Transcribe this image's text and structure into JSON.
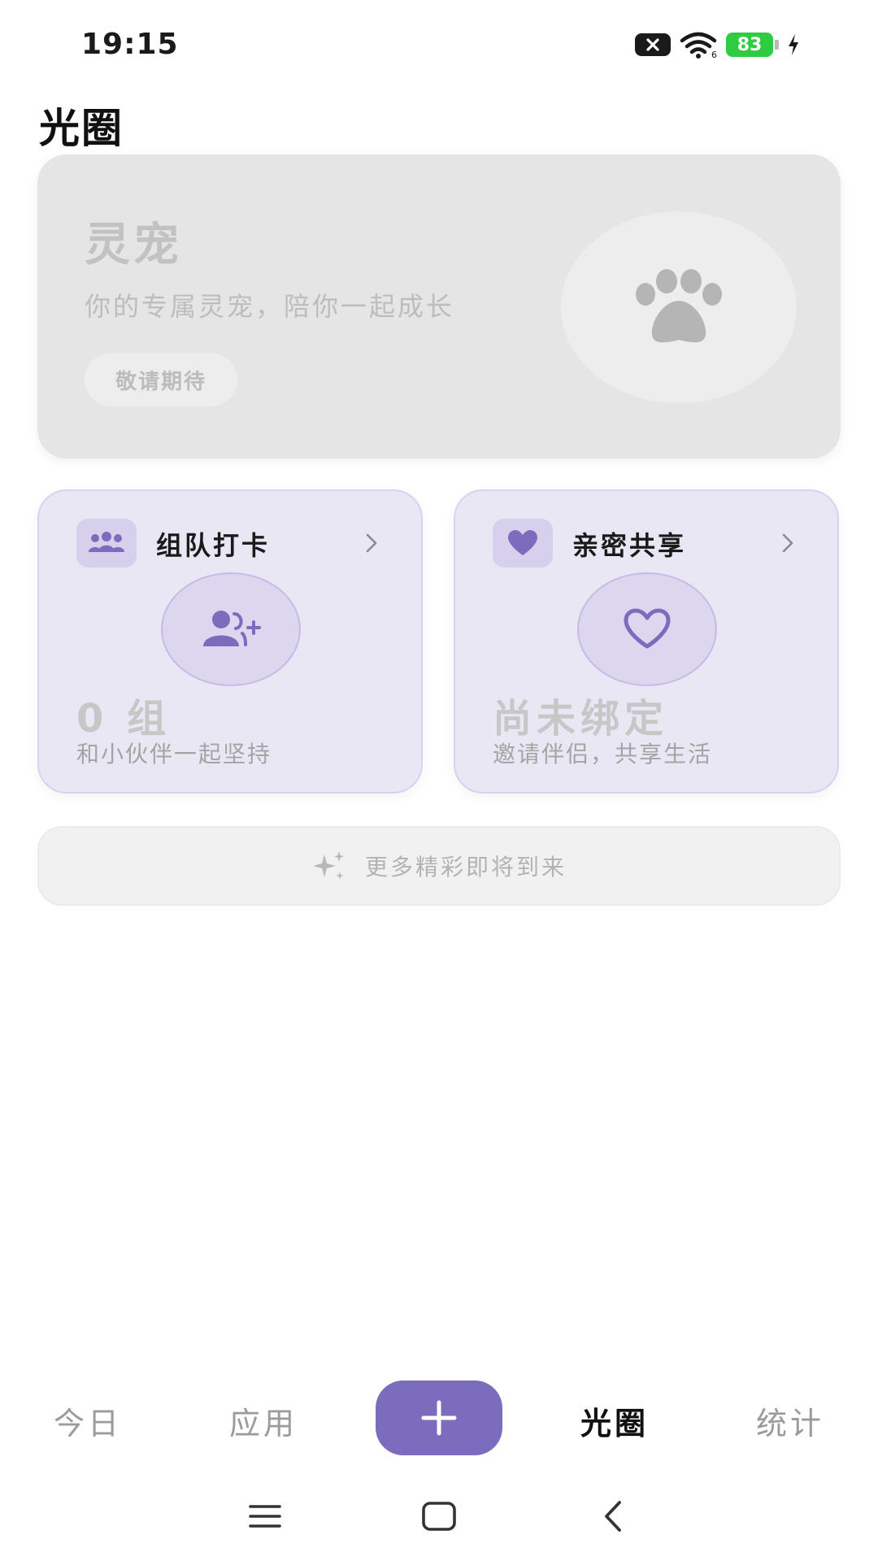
{
  "status_bar": {
    "time": "19:15",
    "battery": "83"
  },
  "page": {
    "title": "光圈"
  },
  "pet_card": {
    "title": "灵宠",
    "subtitle": "你的专属灵宠，陪你一起成长",
    "button_label": "敬请期待",
    "icon": "paw-icon"
  },
  "team_card": {
    "title": "组队打卡",
    "value": "0 组",
    "description": "和小伙伴一起坚持",
    "icon": "group-icon",
    "center_icon": "add-user-icon"
  },
  "share_card": {
    "title": "亲密共享",
    "value": "尚未绑定",
    "description": "邀请伴侣，共享生活",
    "icon": "heart-icon",
    "center_icon": "heart-outline-icon"
  },
  "more_banner": {
    "text": "更多精彩即将到来",
    "icon": "sparkle-icon"
  },
  "bottom_nav": {
    "items": [
      {
        "label": "今日"
      },
      {
        "label": "应用"
      },
      {
        "label": "光圈"
      },
      {
        "label": "统计"
      }
    ],
    "active_index": 2,
    "add_icon": "plus-icon"
  },
  "colors": {
    "accent": "#7b6cbd",
    "card_lavender": "#eae7f5",
    "battery_green": "#2ecc40"
  }
}
